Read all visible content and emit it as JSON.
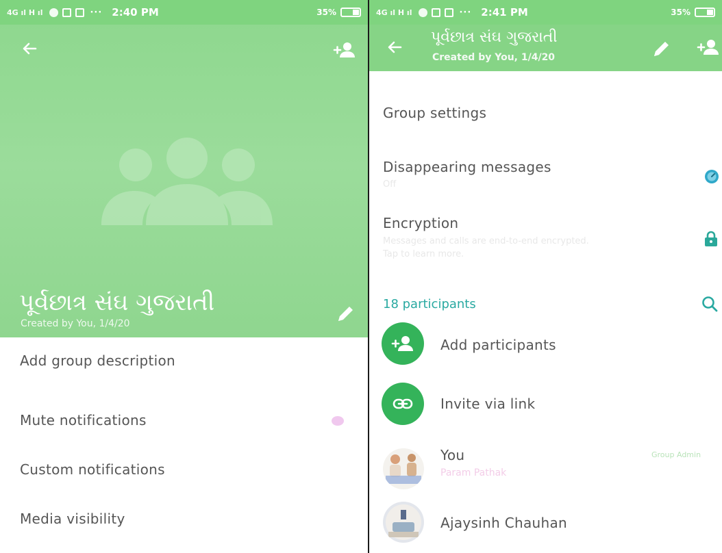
{
  "left": {
    "status": {
      "network": "4G ıl H ıl",
      "more": "···",
      "time": "2:40 PM",
      "battery": "35%"
    },
    "header": {
      "group_name": "પૂર્વછાત્ર સંઘ ગુજરાતી",
      "created": "Created by You, 1/4/20"
    },
    "rows": [
      {
        "label": "Add group description"
      },
      {
        "label": "Mute notifications"
      },
      {
        "label": "Custom notifications"
      },
      {
        "label": "Media visibility"
      }
    ]
  },
  "right": {
    "status": {
      "network": "4G ıl H ıl",
      "more": "···",
      "time": "2:41 PM",
      "battery": "35%"
    },
    "header": {
      "group_name": "પૂર્વછાત્ર સંઘ ગુજરાતી",
      "created": "Created by You, 1/4/20"
    },
    "settings": {
      "group_settings": "Group settings",
      "disappearing": {
        "label": "Disappearing messages",
        "value": "Off"
      },
      "encryption": {
        "label": "Encryption",
        "desc_line1": "Messages and calls are end-to-end encrypted.",
        "desc_line2": "Tap to learn more."
      }
    },
    "participants": {
      "count_label": "18 participants",
      "add_label": "Add participants",
      "invite_label": "Invite via link",
      "members": [
        {
          "name": "You",
          "sub": "Param Pathak",
          "badge": "Group Admin"
        },
        {
          "name": "Ajaysinh Chauhan"
        }
      ]
    }
  },
  "colors": {
    "header_green": "#8fd88f",
    "accent_teal": "#29a9a1",
    "button_green": "#34b35a"
  },
  "icons": [
    "back-arrow-icon",
    "add-person-icon",
    "pencil-icon",
    "timer-icon",
    "lock-icon",
    "search-icon",
    "link-icon"
  ]
}
